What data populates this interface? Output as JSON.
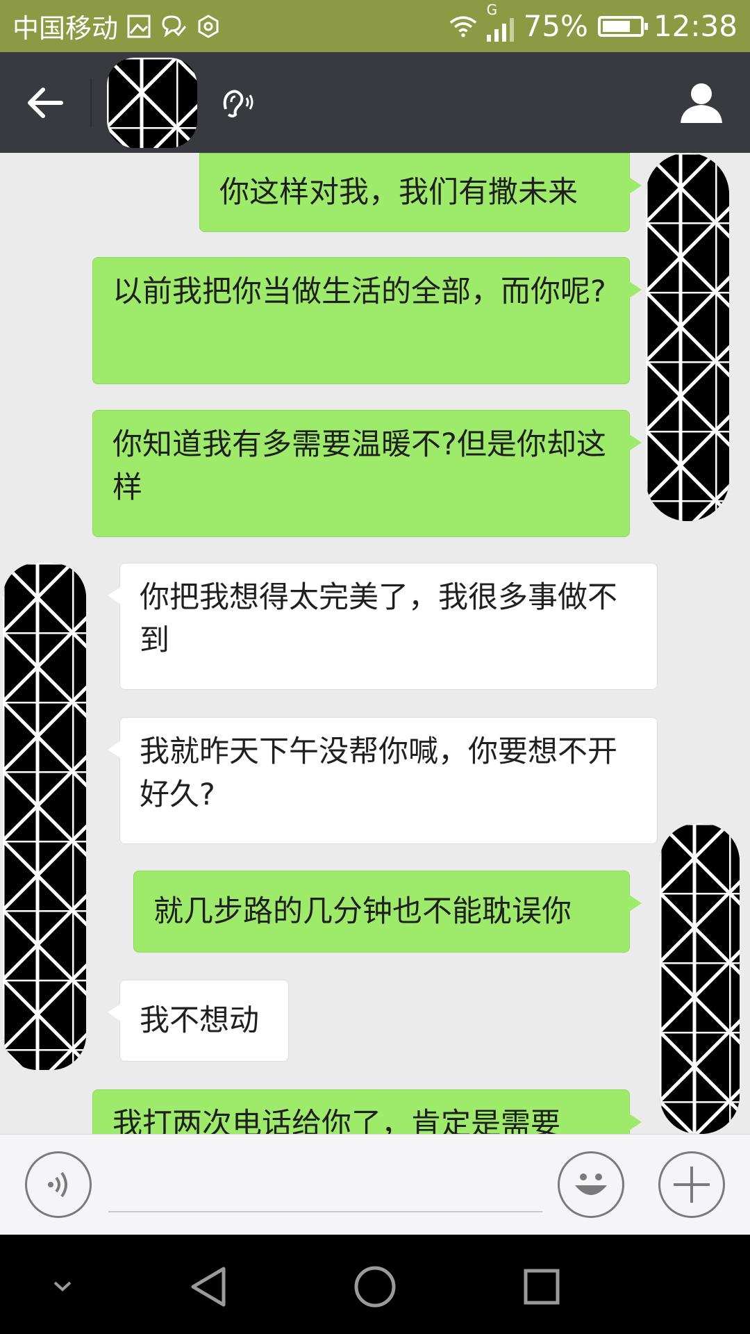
{
  "status_bar": {
    "carrier": "中国移动",
    "network_type": "G",
    "battery": "75%",
    "battery_level": 0.75,
    "time": "12:38",
    "icons": [
      "gallery-icon",
      "notification-icon",
      "settings-hex-icon",
      "wifi-icon",
      "signal-icon",
      "battery-icon"
    ]
  },
  "title_bar": {
    "icons": [
      "back-arrow-icon",
      "earpiece-mode-icon",
      "profile-icon"
    ]
  },
  "messages": [
    {
      "side": "sent",
      "text": "你这样对我，我们有撒未来"
    },
    {
      "side": "sent",
      "text": "以前我把你当做生活的全部，而你呢?"
    },
    {
      "side": "sent",
      "text": "你知道我有多需要温暖不?但是你却这样"
    },
    {
      "side": "recv",
      "text": "你把我想得太完美了，我很多事做不到"
    },
    {
      "side": "recv",
      "text": "我就昨天下午没帮你喊，你要想不开好久?"
    },
    {
      "side": "sent",
      "text": "就几步路的几分钟也不能耽误你"
    },
    {
      "side": "recv",
      "text": "我不想动"
    },
    {
      "side": "sent",
      "text": "我打两次电话给你了，肯定是需要"
    }
  ],
  "input_bar": {
    "value": "",
    "icons": [
      "voice-input-icon",
      "emoji-icon",
      "plus-icon"
    ]
  },
  "nav_bar": {
    "icons": [
      "collapse-chevron-icon",
      "nav-back-icon",
      "nav-home-icon",
      "nav-recents-icon"
    ]
  },
  "colors": {
    "status_bar": "#8d9a44",
    "title_bar": "#393a3f",
    "sent_bubble": "#9eea6a",
    "recv_bubble": "#ffffff",
    "chat_bg": "#ebebeb"
  }
}
